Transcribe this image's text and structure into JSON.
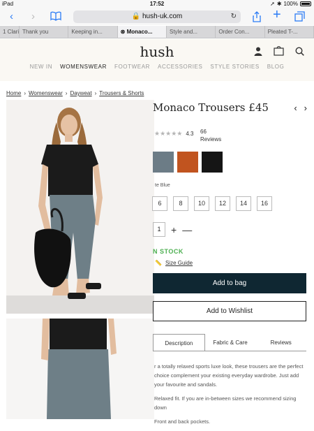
{
  "status": {
    "device": "iPad",
    "time": "17:52",
    "battery": "100%"
  },
  "browser": {
    "url": "hush-uk.com",
    "tabs": [
      {
        "label": "1 Clari"
      },
      {
        "label": "Thank you"
      },
      {
        "label": "Keeping in..."
      },
      {
        "label": "Monaco..."
      },
      {
        "label": "Style and..."
      },
      {
        "label": "Order Con..."
      },
      {
        "label": "Pleated T-..."
      }
    ]
  },
  "site": {
    "logo": "hush",
    "nav": [
      "NEW IN",
      "WOMENSWEAR",
      "FOOTWEAR",
      "ACCESSORIES",
      "STYLE STORIES",
      "BLOG"
    ]
  },
  "breadcrumb": [
    "Home",
    "Womenswear",
    "Dayweat",
    "Trousers & Shorts"
  ],
  "product": {
    "title": "Monaco Trousers £45",
    "rating": "4.3",
    "reviews_count": "66",
    "reviews_label": "Reviews",
    "swatches": [
      {
        "name": "grey-blue",
        "color": "#6c7c86"
      },
      {
        "name": "rust",
        "color": "#c1541f"
      },
      {
        "name": "black",
        "color": "#151515"
      }
    ],
    "colour_name": "te Blue",
    "sizes": [
      "6",
      "8",
      "10",
      "12",
      "14",
      "16"
    ],
    "quantity": "1",
    "stock": "N STOCK",
    "size_guide": "Size Guide",
    "add_to_bag": "Add to bag",
    "add_to_wishlist": "Add to Wishlist",
    "tabs": [
      "Description",
      "Fabric & Care",
      "Reviews"
    ],
    "description": [
      "r a totally relaxed sports luxe look, these trousers are the perfect choice complement your existing everyday wardrobe. Just add your favourite and sandals.",
      "Relaxed fit. If you are in-between sizes we recommend sizing down",
      "Front and back pockets."
    ]
  }
}
